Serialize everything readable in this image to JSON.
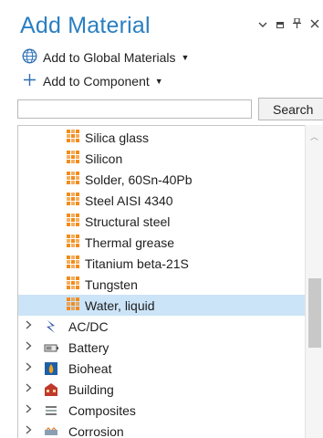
{
  "panel": {
    "title": "Add Material",
    "controls": {
      "dropdown": "⌄",
      "pin": "ᵽ",
      "close": "✕"
    }
  },
  "actions": {
    "global": "Add to Global Materials",
    "component": "Add to Component"
  },
  "search": {
    "value": "",
    "button": "Search"
  },
  "materials": [
    "Silica glass",
    "Silicon",
    "Solder, 60Sn-40Pb",
    "Steel AISI 4340",
    "Structural steel",
    "Thermal grease",
    "Titanium beta-21S",
    "Tungsten",
    "Water, liquid"
  ],
  "selected_material": "Water, liquid",
  "categories": [
    {
      "label": "AC/DC",
      "icon": "acdc-icon"
    },
    {
      "label": "Battery",
      "icon": "battery-icon"
    },
    {
      "label": "Bioheat",
      "icon": "bioheat-icon"
    },
    {
      "label": "Building",
      "icon": "building-icon"
    },
    {
      "label": "Composites",
      "icon": "composites-icon"
    },
    {
      "label": "Corrosion",
      "icon": "corrosion-icon"
    }
  ],
  "colors": {
    "accent": "#2a7fc1",
    "selection": "#cce4f7",
    "material_icon": "#f28c1a"
  }
}
